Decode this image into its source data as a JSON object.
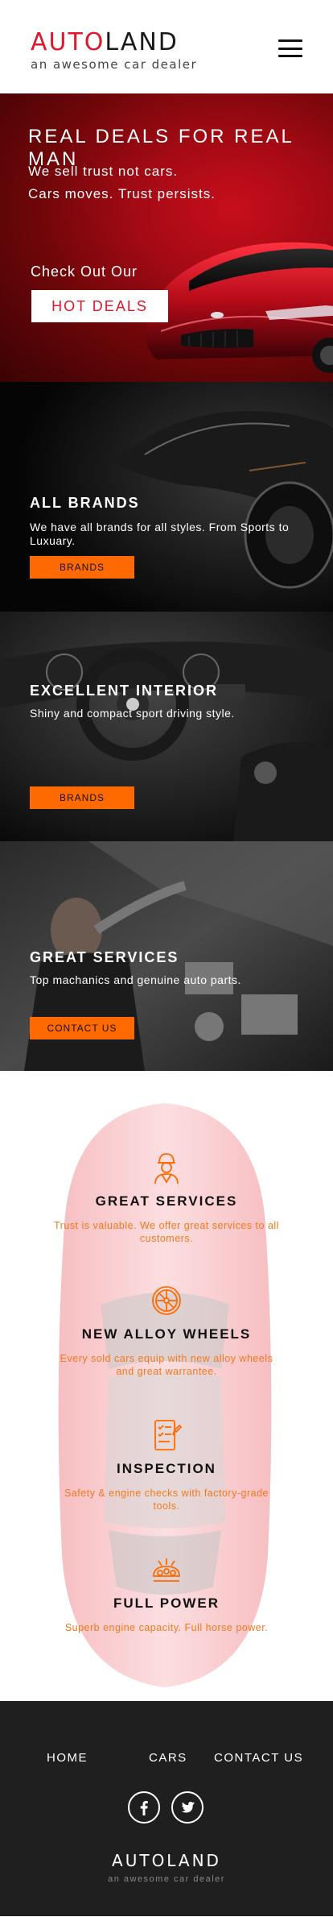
{
  "brand": {
    "name_part1": "AUTO",
    "name_part2": "LAND",
    "tagline": "an awesome car dealer",
    "accent_color": "#e0162b"
  },
  "header": {
    "menu_icon": "hamburger-menu-icon"
  },
  "hero": {
    "title": "REAL DEALS FOR REAL MAN",
    "line1": "We sell trust not cars.",
    "line2": "Cars moves. Trust persists.",
    "checkout_text": "Check Out Our",
    "button_label": "HOT DEALS"
  },
  "panels": [
    {
      "title": "ALL BRANDS",
      "text": "We have all brands for all styles. From Sports to Luxuary.",
      "button_label": "BRANDS"
    },
    {
      "title": "EXCELLENT INTERIOR",
      "text": "Shiny and compact sport driving style.",
      "button_label": "BRANDS"
    },
    {
      "title": "GREAT SERVICES",
      "text": "Top machanics and genuine auto parts.",
      "button_label": "CONTACT US"
    }
  ],
  "button_color": "#ff6a00",
  "services": [
    {
      "icon": "mechanic-icon",
      "title": "GREAT SERVICES",
      "text": "Trust is valuable. We offer great services to all customers."
    },
    {
      "icon": "alloy-wheel-icon",
      "title": "NEW ALLOY WHEELS",
      "text": "Every sold cars equip with new alloy wheels and great warrantee."
    },
    {
      "icon": "inspection-checklist-icon",
      "title": "INSPECTION",
      "text": "Safety & engine checks with factory-grade tools."
    },
    {
      "icon": "engine-power-icon",
      "title": "FULL POWER",
      "text": "Superb engine capacity. Full horse power."
    }
  ],
  "footer": {
    "nav": [
      "HOME",
      "CARS",
      "CONTACT US"
    ],
    "social": [
      "facebook-icon",
      "twitter-icon"
    ],
    "logo": "AUTOLAND",
    "tagline": "an awesome car dealer"
  }
}
